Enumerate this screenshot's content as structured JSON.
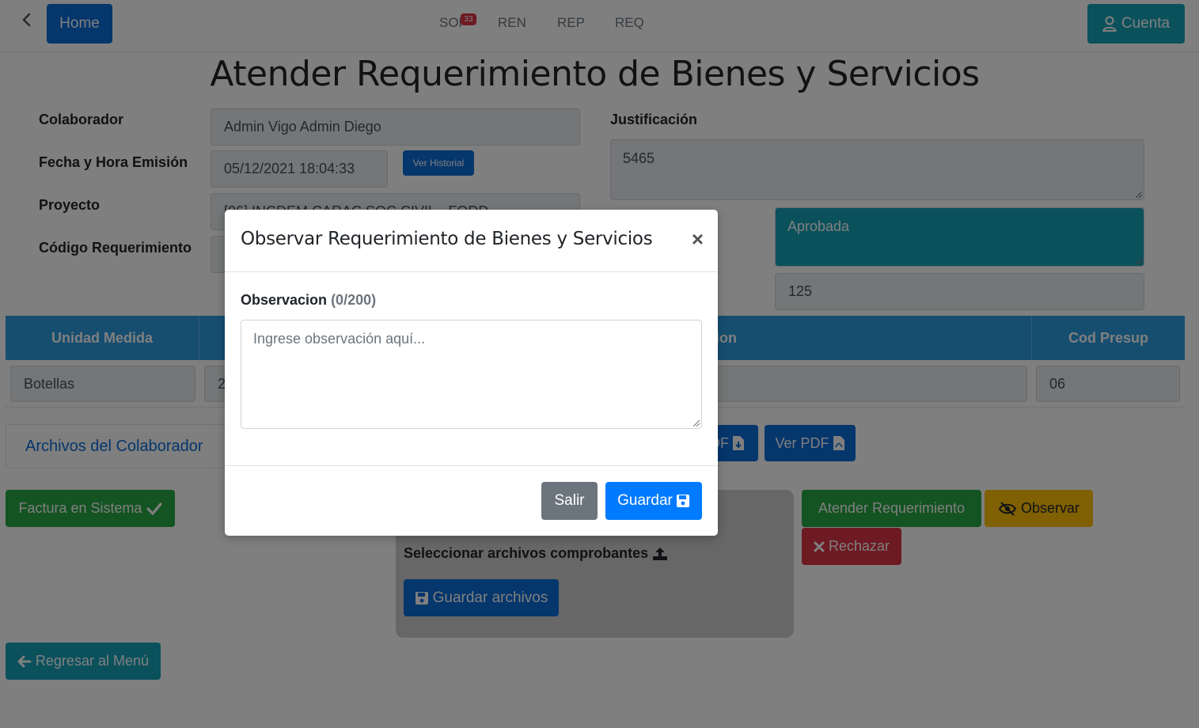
{
  "navbar": {
    "home_label": "Home",
    "links": [
      "SOF",
      "REN",
      "REP",
      "REQ"
    ],
    "sof_badge": "33",
    "account_label": "Cuenta"
  },
  "page": {
    "title": "Atender Requerimiento de Bienes y Servicios",
    "colaborador_label": "Colaborador",
    "colaborador_value": "Admin Vigo Admin Diego",
    "fecha_label": "Fecha y Hora Emisión",
    "fecha_value": "05/12/2021 18:04:33",
    "ver_historial_label": "Ver Historial",
    "proyecto_label": "Proyecto",
    "proyecto_value": "[06] INCDEM CARAC SOC CIVIL - FODD",
    "codigo_label": "Código Requerimiento",
    "justificacion_label": "Justificación",
    "justificacion_value": "5465",
    "estado_value": "Aprobada",
    "cantidad_value": "125"
  },
  "table": {
    "headers": [
      "Unidad Medida",
      "",
      "ion",
      "Cod Presup"
    ],
    "row": {
      "unidad": "Botellas",
      "cantidad_partial": "2",
      "cod_presup": "06"
    }
  },
  "files": {
    "archivos_label": "Archivos del Colaborador",
    "descargar_partial": "DF",
    "ver_pdf_label": "Ver PDF"
  },
  "actions": {
    "factura_label": "Factura en Sistema",
    "upload_label": "Seleccionar archivos comprobantes",
    "guardar_archivos_label": "Guardar archivos",
    "atender_label": "Atender Requerimiento",
    "observar_label": "Observar",
    "rechazar_label": "Rechazar",
    "regresar_label": "Regresar al Menú"
  },
  "modal": {
    "title": "Observar Requerimiento de Bienes y Servicios",
    "close_symbol": "×",
    "field_label": "Observacion",
    "field_count": "(0/200)",
    "placeholder": "Ingrese observación aquí...",
    "salir_label": "Salir",
    "guardar_label": "Guardar"
  },
  "colors": {
    "primary": "#0b6cd8",
    "info": "#17a2b8",
    "success": "#28a745",
    "warning": "#ffc107",
    "danger": "#dc3545",
    "secondary": "#6c757d",
    "table_header": "#2c9ce0"
  }
}
